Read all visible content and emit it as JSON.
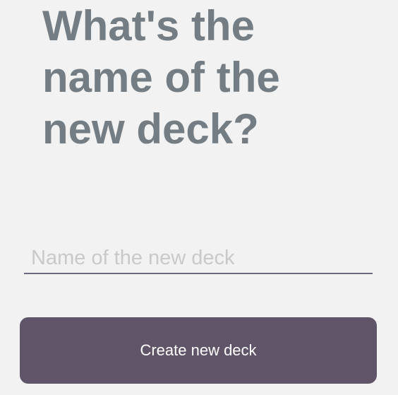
{
  "screen": {
    "title": "What's the name of the new deck?"
  },
  "deck_form": {
    "name_input": {
      "value": "",
      "placeholder": "Name of the new deck"
    },
    "create_button_label": "Create new deck"
  },
  "colors": {
    "background": "#f2f2f2",
    "title_text": "#737d83",
    "input_underline": "#6e6880",
    "placeholder_text": "#c9c9c9",
    "button_background": "#605568",
    "button_text": "#ffffff"
  }
}
